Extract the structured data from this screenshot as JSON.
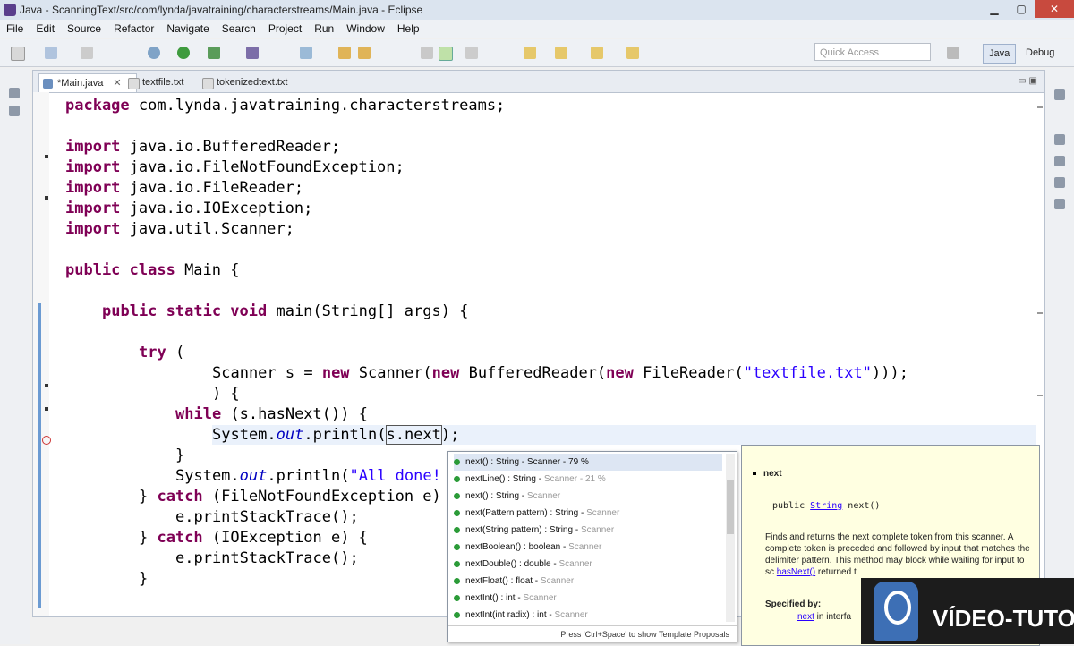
{
  "window": {
    "title": "Java - ScanningText/src/com/lynda/javatraining/characterstreams/Main.java - Eclipse"
  },
  "menu": [
    "File",
    "Edit",
    "Source",
    "Refactor",
    "Navigate",
    "Search",
    "Project",
    "Run",
    "Window",
    "Help"
  ],
  "toolbar": {
    "quick_access_placeholder": "Quick Access",
    "perspective_java": "Java",
    "perspective_debug": "Debug"
  },
  "tabs": [
    {
      "label": "*Main.java",
      "close": "✕"
    },
    {
      "label": "textfile.txt"
    },
    {
      "label": "tokenizedtext.txt"
    }
  ],
  "code": {
    "l1": [
      "package",
      " com.lynda.javatraining.characterstreams;"
    ],
    "l3": [
      "import",
      " java.io.BufferedReader;"
    ],
    "l4": [
      "import",
      " java.io.FileNotFoundException;"
    ],
    "l5": [
      "import",
      " java.io.FileReader;"
    ],
    "l6": [
      "import",
      " java.io.IOException;"
    ],
    "l7": [
      "import",
      " java.util.Scanner;"
    ],
    "l9": [
      "public class",
      " Main {"
    ],
    "l11": [
      "public static void",
      " main(String[] args) {"
    ],
    "l13": [
      "try",
      " ("
    ],
    "l14a": "Scanner s = ",
    "l14b": "new",
    "l14c": " Scanner(",
    "l14d": "new",
    "l14e": " BufferedReader(",
    "l14f": "new",
    "l14g": " FileReader(",
    "l14h": "\"textfile.txt\"",
    "l14i": ")));",
    "l15": ") {",
    "l16": [
      "while",
      " (s.hasNext()) {"
    ],
    "l17a": "System.",
    "l17b": "out",
    "l17c": ".println(",
    "l17d": "s.next",
    "l17e": ");",
    "l18": "}",
    "l19a": "System.",
    "l19b": "out",
    "l19c": ".println(",
    "l19d": "\"All done!",
    "l20": [
      "} ",
      "catch",
      " (FileNotFoundException e)"
    ],
    "l21": "e.printStackTrace();",
    "l22": [
      "} ",
      "catch",
      " (IOException e) {"
    ],
    "l23": "e.printStackTrace();",
    "l24": "}"
  },
  "assist": {
    "items": [
      {
        "main": "next() : String - Scanner - 79 %",
        "qual": ""
      },
      {
        "main": "nextLine() : String - ",
        "qual": "Scanner - 21 %"
      },
      {
        "main": "next() : String - ",
        "qual": "Scanner"
      },
      {
        "main": "next(Pattern pattern) : String - ",
        "qual": "Scanner"
      },
      {
        "main": "next(String pattern) : String - ",
        "qual": "Scanner"
      },
      {
        "main": "nextBoolean() : boolean - ",
        "qual": "Scanner"
      },
      {
        "main": "nextDouble() : double - ",
        "qual": "Scanner"
      },
      {
        "main": "nextFloat() : float - ",
        "qual": "Scanner"
      },
      {
        "main": "nextInt() : int - ",
        "qual": "Scanner"
      },
      {
        "main": "nextInt(int radix) : int - ",
        "qual": "Scanner"
      }
    ],
    "footer": "Press 'Ctrl+Space' to show Template Proposals"
  },
  "doc": {
    "heading": "next",
    "sig_prefix": "public ",
    "sig_type": "String",
    "sig_suffix": " next()",
    "desc": "Finds and returns the next complete token from this scanner. A complete token is preceded and followed by input that matches the delimiter pattern. This method may block while waiting for input to sc",
    "desc_link": "hasNext()",
    "desc_end": " returned t",
    "spec": "Specified by:",
    "spec_link": "next",
    "spec_end": " in interfa"
  },
  "watermark": "VÍDEO-TUTOR",
  "colors": {
    "keyword": "#7f0055",
    "string": "#2a00ff",
    "field": "#0000c0",
    "accent": "#6c9bd2"
  }
}
